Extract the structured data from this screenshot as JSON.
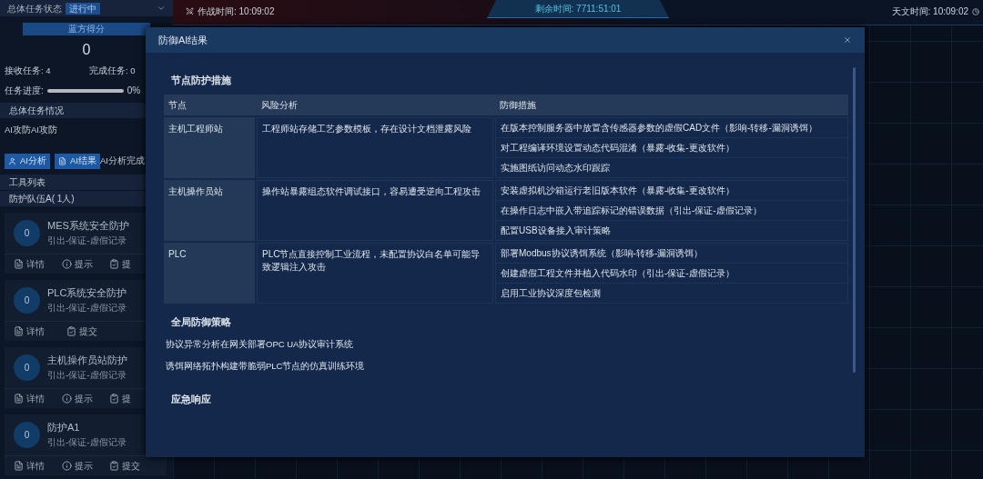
{
  "sidebar": {
    "status_label": "总体任务状态",
    "status_badge": "进行中",
    "score_title": "蓝方得分",
    "score": "0",
    "received": "接收任务:  4",
    "completed": "完成任务:  0",
    "progress_label": "任务进度:",
    "progress": {
      "level": 0
    },
    "progress_text": "0%",
    "overview_title": "总体任务情况",
    "overview_text": "AI攻防AI攻防",
    "buttons": [
      {
        "kind": "user",
        "label": "AI分析"
      },
      {
        "kind": "file",
        "label": "AI结果"
      }
    ],
    "analysis_status": "AI分析完成",
    "tool_list": "工具列表",
    "team": "防护队伍A( 1人)",
    "cards": [
      {
        "score": "0",
        "title": "MES系统安全防护",
        "subtitle": "引出-保证-虚假记录",
        "actions": [
          {
            "kind": "detail",
            "label": "详情"
          },
          {
            "kind": "hint",
            "label": "提示"
          },
          {
            "kind": "submit",
            "label": "提"
          }
        ]
      },
      {
        "score": "0",
        "title": "PLC系统安全防护",
        "subtitle": "引出-保证-虚假记录",
        "actions": [
          {
            "kind": "detail",
            "label": "详情"
          },
          {
            "kind": "submit",
            "label": "提交"
          }
        ]
      },
      {
        "score": "0",
        "title": "主机操作员站防护",
        "subtitle": "引出-保证-虚假记录",
        "actions": [
          {
            "kind": "detail",
            "label": "详情"
          },
          {
            "kind": "hint",
            "label": "提示"
          },
          {
            "kind": "submit",
            "label": "提"
          }
        ]
      },
      {
        "score": "0",
        "title": "防护A1",
        "subtitle": "引出-保证-虚假记录",
        "actions": [
          {
            "kind": "detail",
            "label": "详情"
          },
          {
            "kind": "hint",
            "label": "提示"
          },
          {
            "kind": "submit",
            "label": "提交"
          }
        ]
      }
    ]
  },
  "top_bar": {
    "battle_time": "作战时间:  10:09:02",
    "remaining_time": "剩余时间:  7711:51:01",
    "astro_time": "天文时间:  10:09:02"
  },
  "dialog": {
    "title": "防御AI结果",
    "node_section": "节点防护措施",
    "table": {
      "columns": [
        "节点",
        "风险分析",
        "防御措施"
      ],
      "rows": [
        {
          "node": "主机工程师站",
          "risk": "工程师站存储工艺参数模板，存在设计文档泄露风险",
          "measures": [
            "在版本控制服务器中放置含传感器参数的虚假CAD文件（影响-转移-漏洞诱饵）",
            "对工程编译环境设置动态代码混淆（暴露-收集-更改软件）",
            "实施图纸访问动态水印跟踪"
          ]
        },
        {
          "node": "主机操作员站",
          "risk": "操作站暴露组态软件调试接口，容易遭受逆向工程攻击",
          "measures": [
            "安装虚拟机沙箱运行老旧版本软件（暴露-收集-更改软件）",
            "在操作日志中嵌入带追踪标记的错误数据（引出-保证-虚假记录）",
            "配置USB设备接入审计策略"
          ]
        },
        {
          "node": "PLC",
          "risk": "PLC节点直接控制工业流程，未配置协议白名单可能导致逻辑注入攻击",
          "measures": [
            "部署Modbus协议诱饵系统（影响-转移-漏洞诱饵）",
            "创建虚假工程文件并植入代码水印（引出-保证-虚假记录）",
            "启用工业协议深度包检测"
          ]
        }
      ]
    },
    "global_section": "全局防御策略",
    "global_items": [
      "协议异常分析在网关部署OPC UA协议审计系统",
      "诱饵网络拓扑构建带脆弱PLC节点的仿真训练环境"
    ],
    "emergency_section": "应急响应"
  }
}
